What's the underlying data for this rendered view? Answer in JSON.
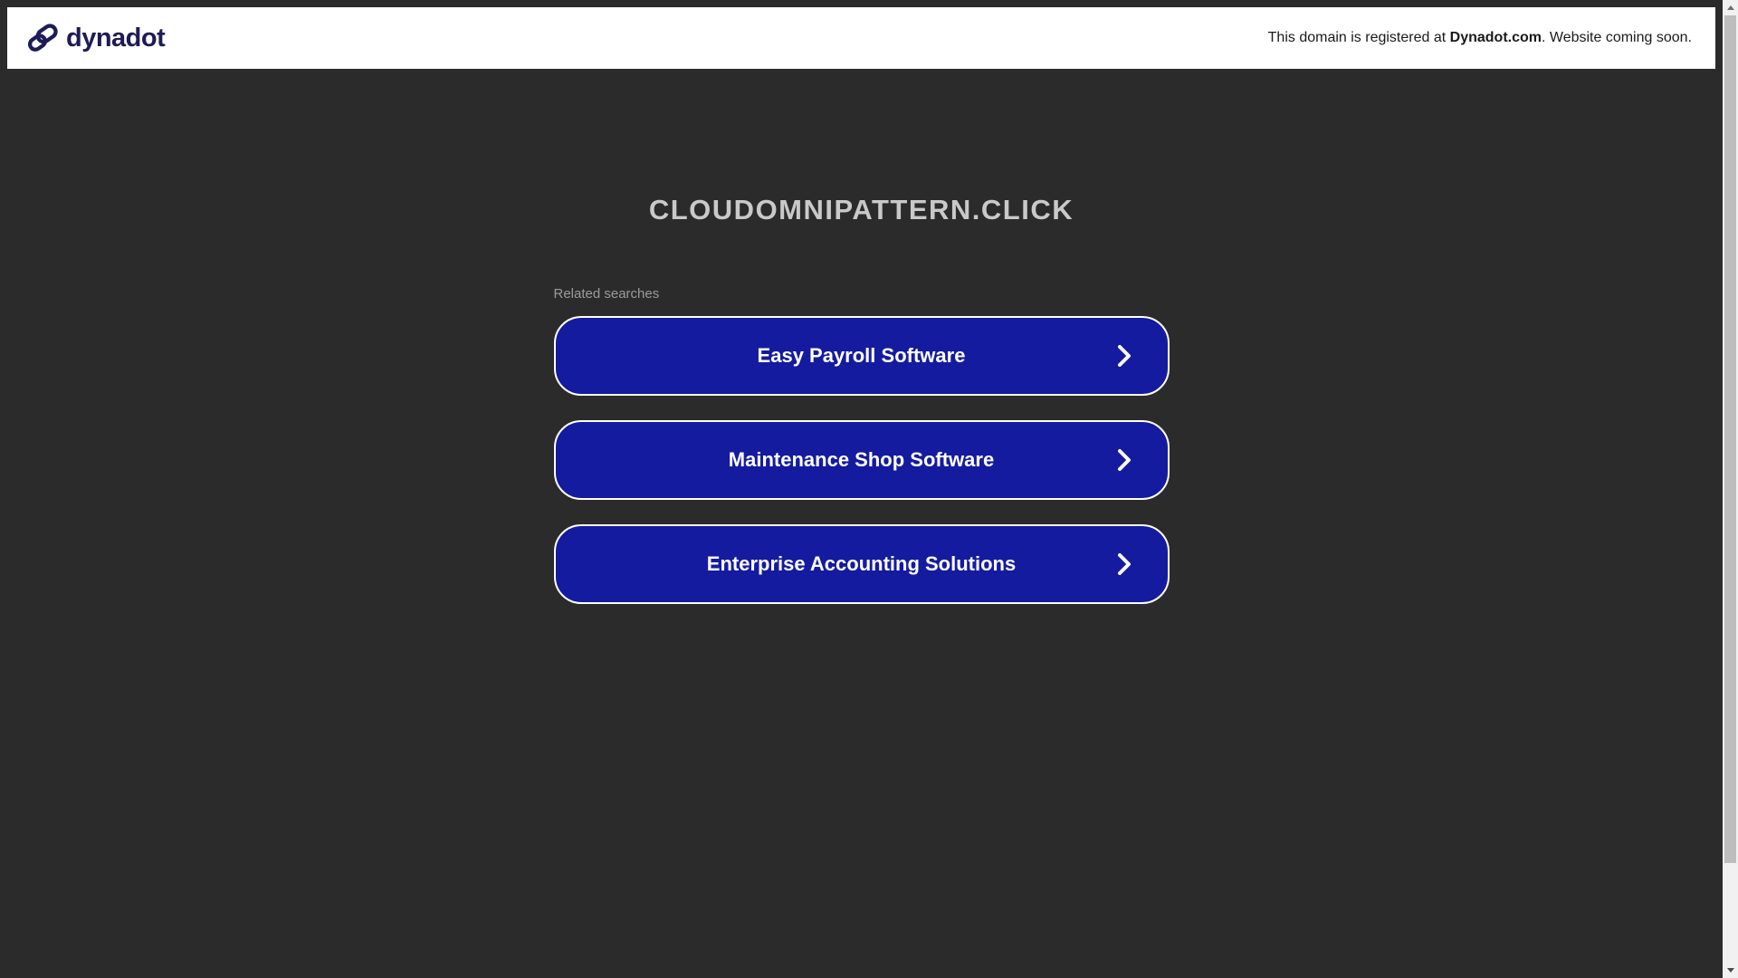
{
  "header": {
    "logo_text": "dynadot",
    "notice_prefix": "This domain is registered at ",
    "notice_brand": "Dynadot.com",
    "notice_suffix": ". Website coming soon."
  },
  "main": {
    "domain_title": "CLOUDOMNIPATTERN.CLICK",
    "related_label": "Related searches",
    "related_links": [
      {
        "label": "Easy Payroll Software"
      },
      {
        "label": "Maintenance Shop Software"
      },
      {
        "label": "Enterprise Accounting Solutions"
      }
    ]
  },
  "icons": {
    "logo_mark": "chain-link-icon",
    "button_arrow": "chevron-right-icon",
    "scrollbar_up": "triangle-up-icon",
    "scrollbar_down": "triangle-down-icon"
  },
  "colors": {
    "page_background": "#2b2b2b",
    "header_background": "#ffffff",
    "logo_navy": "#1e1c55",
    "button_blue": "#141b9e",
    "button_border": "#ffffff",
    "title_gray": "#c9c9c9",
    "related_label_gray": "#9b9b9b",
    "scrollbar_track": "#f1f1f1",
    "scrollbar_thumb": "#bdbdbd"
  }
}
